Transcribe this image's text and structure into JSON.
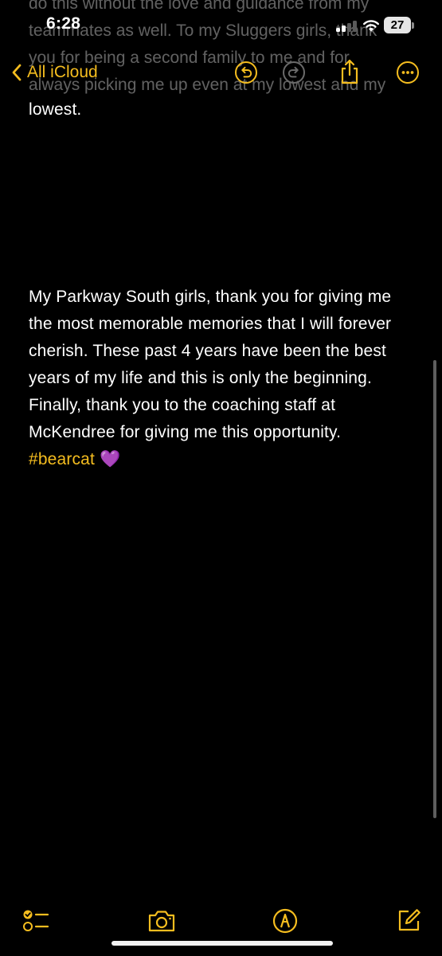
{
  "status_bar": {
    "time": "6:28",
    "battery": "27"
  },
  "nav": {
    "back_label": "All iCloud"
  },
  "ghost_lines": [
    "do this without the love and guidance from my",
    "teammates as well. To my Sluggers girls, thank",
    "you for being a second family to me and for",
    "always picking me up even at my lowest and my"
  ],
  "note": {
    "line_top": "lowest.",
    "paragraph": [
      " My Parkway South girls, thank you for giving me",
      "the most memorable memories that I will forever",
      "cherish. These past 4 years have been the best",
      "years of my life and this is only the beginning.",
      "Finally, thank you to the coaching staff at",
      "McKendree for giving me this opportunity."
    ],
    "hashtag": "#bearcat",
    "emoji": "💜"
  },
  "colors": {
    "accent": "#f5bd1f",
    "background": "#000000",
    "text": "#ffffff"
  },
  "icons": {
    "nav": [
      "chevron-left-icon",
      "undo-icon",
      "redo-icon",
      "share-icon",
      "more-icon"
    ],
    "toolbar": [
      "checklist-icon",
      "camera-icon",
      "markup-icon",
      "compose-icon"
    ]
  }
}
